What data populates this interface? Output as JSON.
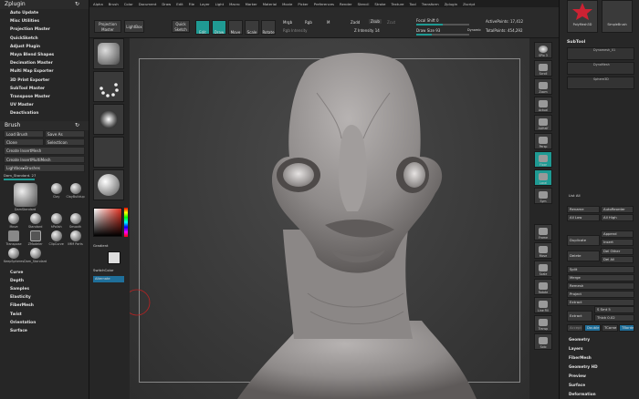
{
  "top_menu": [
    "Alpha",
    "Brush",
    "Color",
    "Document",
    "Draw",
    "Edit",
    "File",
    "Layer",
    "Light",
    "Macro",
    "Marker",
    "Material",
    "Movie",
    "Picker",
    "Preferences",
    "Render",
    "Stencil",
    "Stroke",
    "Texture",
    "Tool",
    "Transform",
    "Zplugin",
    "Zscript"
  ],
  "zplugin": {
    "title": "Zplugin",
    "items": [
      "Auto Update",
      "Misc Utilities",
      "Projection Master",
      "QuickSketch",
      "Adjust Plugin",
      "Maya Blend Shapes",
      "Decimation Master",
      "Multi Map Exporter",
      "3D Print Exporter",
      "SubTool Master",
      "Transpose Master",
      "UV Master",
      "Deactivation"
    ]
  },
  "brush": {
    "title": "Brush",
    "load": "Load Brush",
    "save": "Save As",
    "clone": "Clone",
    "select_icon": "SelectIcon",
    "create_insert": "Create InsertMesh",
    "create_insert_multi": "Create InsertMultiMesh",
    "lightbox": "Lightbox▸Brushes",
    "current": "Dam_Standard. 27",
    "grid": [
      "DamStandard",
      "Clay",
      "ClayBuildup",
      "Move",
      "Standard",
      "hPolish",
      "Smooth",
      "Transpose",
      "ZModeler",
      "ClipCurve",
      "IMM Parts",
      "KeepSpheres",
      "Dam_Standard"
    ]
  },
  "sub_palettes": [
    "Curve",
    "Depth",
    "Samples",
    "Elasticity",
    "FiberMesh",
    "Twist",
    "Orientation",
    "Surface"
  ],
  "toolbar": {
    "projection_master": "Projection Master",
    "lightbox": "LightBox",
    "quick_sketch": "Quick Sketch",
    "edit": "Edit",
    "draw": "Draw",
    "move": "Move",
    "scale": "Scale",
    "rotate": "Rotate",
    "mrgb": "Mrgb",
    "rgb": "Rgb",
    "m": "M",
    "rgb_intensity": "Rgb Intensity",
    "zadd": "Zadd",
    "zsub": "Zsub",
    "zcut": "Zcut",
    "z_intensity": "Z Intensity 14",
    "focal_shift": "Focal Shift 0",
    "draw_size": "Draw Size 93",
    "dynamic": "Dynamic",
    "active_points": "ActivePoints: 17,412",
    "total_points": "TotalPoints: 454,292"
  },
  "shelf": {
    "gradient": "Gradient",
    "switch_color": "SwitchColor",
    "alternate": "Alternate"
  },
  "right_shelf": [
    "SPix 3",
    "Scroll",
    "Zoom",
    "Actual",
    "AAHalf",
    "Persp",
    "Floor",
    "Local",
    "Sym",
    "Frame",
    "Move",
    "Scale",
    "Rotate",
    "Line Fill",
    "Transp",
    "Solo"
  ],
  "subtool": {
    "title": "SubTool",
    "goz": "PolyMesh3D",
    "goz2": "SimpleBrush",
    "layers": [
      "Dynamesh_01",
      "DynaMesh",
      "Sphere3D"
    ],
    "list_all": "List All",
    "rename": "Rename",
    "auto_reorder": "AutoReorder",
    "all_low": "All Low",
    "all_high": "All High",
    "duplicate": "Duplicate",
    "append": "Append",
    "insert": "Insert",
    "delete": "Delete",
    "del_other": "Del Other",
    "del_all": "Del All",
    "split": "Split",
    "merge": "Merge",
    "remesh": "Remesh",
    "project": "Project",
    "extract_hdr": "Extract",
    "extract": "Extract",
    "s_smt": "S Smt 5",
    "thick": "Thick 0.02",
    "accept": "Accept",
    "double": "Double",
    "tcorne": "TCorne",
    "tborder": "TBorder"
  },
  "right_list": [
    "Geometry",
    "Layers",
    "FiberMesh",
    "Geometry HD",
    "Preview",
    "Surface",
    "Deformation"
  ]
}
